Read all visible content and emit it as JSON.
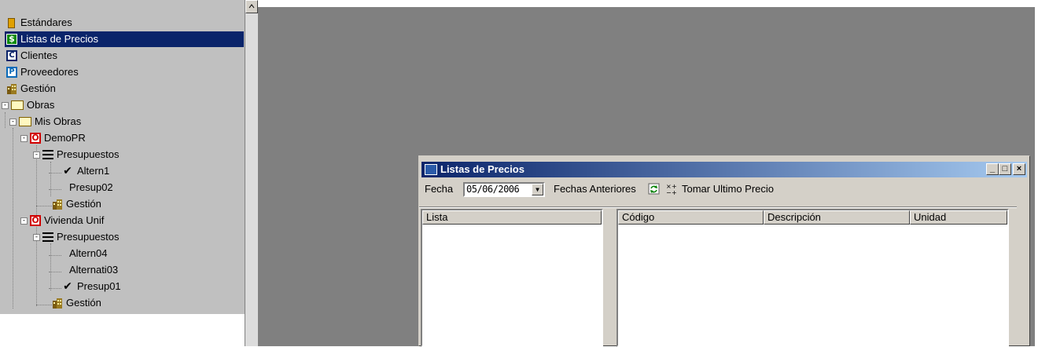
{
  "tree": {
    "items": [
      {
        "label": "Estándares",
        "icon": "book-icon"
      },
      {
        "label": "Listas de Precios",
        "icon": "dollar-icon",
        "selected": true
      },
      {
        "label": "Clientes",
        "icon": "c-icon"
      },
      {
        "label": "Proveedores",
        "icon": "p-icon"
      },
      {
        "label": "Gestión",
        "icon": "building-icon"
      },
      {
        "label": "Obras",
        "icon": "folder-icon",
        "expanded": true
      },
      {
        "label": "Mis Obras",
        "icon": "folder-icon",
        "expanded": true
      },
      {
        "label": "DemoPR",
        "icon": "obra-icon",
        "expanded": true
      },
      {
        "label": "Presupuestos",
        "icon": "list-icon",
        "expanded": true
      },
      {
        "label": "Altern1",
        "icon": "check-icon"
      },
      {
        "label": "Presup02",
        "icon": ""
      },
      {
        "label": "Gestión",
        "icon": "building-icon"
      },
      {
        "label": "Vivienda Unif",
        "icon": "obra-icon",
        "expanded": true
      },
      {
        "label": "Presupuestos",
        "icon": "list-icon",
        "expanded": true
      },
      {
        "label": "Altern04",
        "icon": ""
      },
      {
        "label": "Alternati03",
        "icon": ""
      },
      {
        "label": "Presup01",
        "icon": "check-icon"
      },
      {
        "label": "Gestión",
        "icon": "building-icon"
      }
    ]
  },
  "window": {
    "title": "Listas de Precios",
    "minimize": "_",
    "maximize": "□",
    "close": "×",
    "toolbar": {
      "fecha_label": "Fecha",
      "fecha_value": "05/06/2006",
      "anteriores_label": "Fechas Anteriores",
      "tomar_label": "Tomar Ultimo Precio"
    },
    "left_list": {
      "columns": [
        "Lista"
      ]
    },
    "right_list": {
      "columns": [
        "Código",
        "Descripción",
        "Unidad"
      ]
    }
  },
  "colors": {
    "selection": "#0a246a",
    "desktop": "#808080",
    "face": "#d4d0c8",
    "tree_bg": "#c0c0c0"
  }
}
